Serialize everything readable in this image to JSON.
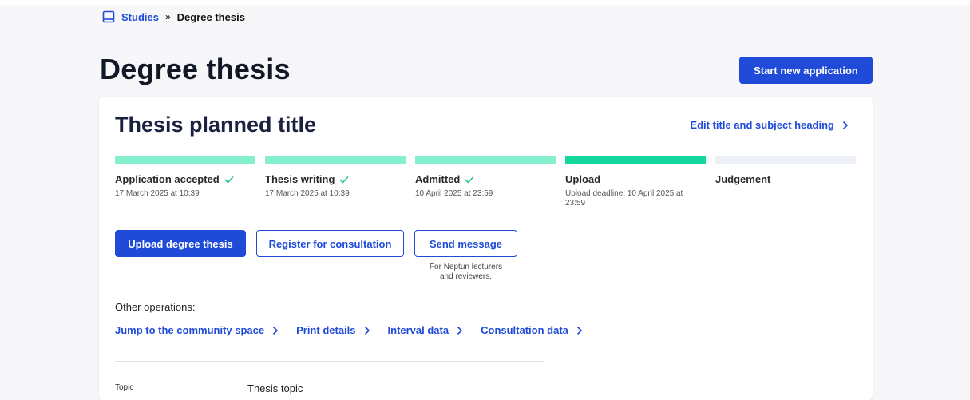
{
  "breadcrumb": {
    "icon": "book-icon",
    "parent": "Studies",
    "separator": "»",
    "current": "Degree thesis"
  },
  "page": {
    "title": "Degree thesis",
    "start_button": "Start new application"
  },
  "thesis": {
    "title": "Thesis planned title",
    "edit_link": "Edit title and subject heading",
    "steps": [
      {
        "label": "Application accepted",
        "date": "17 March 2025 at 10:39",
        "state": "done"
      },
      {
        "label": "Thesis writing",
        "date": "17 March 2025 at 10:39",
        "state": "done"
      },
      {
        "label": "Admitted",
        "date": "10 April 2025 at 23:59",
        "state": "done"
      },
      {
        "label": "Upload",
        "date": "Upload deadline: 10 April 2025 at 23:59",
        "state": "current"
      },
      {
        "label": "Judgement",
        "date": "",
        "state": "pending"
      }
    ],
    "actions": {
      "upload": "Upload degree thesis",
      "consultation": "Register for consultation",
      "message": "Send message",
      "message_note": "For Neptun lecturers and reviewers."
    },
    "other_operations": {
      "label": "Other operations:",
      "links": [
        "Jump to the community space",
        "Print details",
        "Interval data",
        "Consultation data"
      ]
    },
    "topic": {
      "label": "Topic",
      "value": "Thesis topic"
    }
  },
  "colors": {
    "accent": "#1f4bd8",
    "step_done": "#86efcf",
    "step_current": "#14d79c",
    "step_pending": "#eef0f7",
    "check": "#22c58b"
  }
}
